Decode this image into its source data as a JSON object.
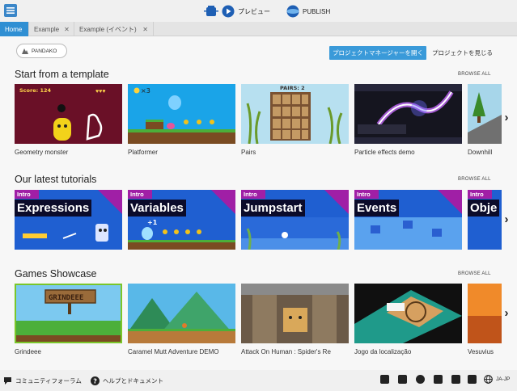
{
  "toolbar": {
    "preview_label": "プレビュー",
    "publish_label": "PUBLISH"
  },
  "tabs": [
    {
      "label": "Home"
    },
    {
      "label": "Example"
    },
    {
      "label": "Example (イベント)"
    }
  ],
  "top": {
    "pandako_label": "PANDAKO",
    "open_pm_label": "プロジェクトマネージャーを開く",
    "see_projects_label": "プロジェクトを見じる"
  },
  "templates": {
    "title": "Start from a template",
    "browse": "BROWSE ALL",
    "items": [
      {
        "label": "Geometry monster",
        "score": "Score: 124"
      },
      {
        "label": "Platformer",
        "lives": "×3"
      },
      {
        "label": "Pairs",
        "pairs": "PAIRS: 2"
      },
      {
        "label": "Particle effects demo"
      },
      {
        "label": "Downhill"
      }
    ]
  },
  "tutorials": {
    "title": "Our latest tutorials",
    "browse": "BROWSE ALL",
    "items": [
      {
        "intro": "Intro",
        "name": "Expressions"
      },
      {
        "intro": "Intro",
        "name": "Variables",
        "badge": "+1"
      },
      {
        "intro": "Intro",
        "name": "Jumpstart"
      },
      {
        "intro": "Intro",
        "name": "Events"
      },
      {
        "intro": "Intro",
        "name": "Obje"
      }
    ]
  },
  "showcase": {
    "title": "Games Showcase",
    "browse": "BROWSE ALL",
    "items": [
      {
        "label": "Grindeee",
        "sign": "GRINDEEE"
      },
      {
        "label": "Caramel Mutt Adventure DEMO"
      },
      {
        "label": "Attack On Human : Spider's Re"
      },
      {
        "label": "Jogo da localização"
      },
      {
        "label": "Vesuvius"
      }
    ]
  },
  "footer": {
    "forum_label": "コミュニティフォーラム",
    "help_label": "ヘルプとドキュメント",
    "lang_label": "JA-JP"
  },
  "colors": {
    "accent": "#2f8fd3",
    "tutorial_bg": "#1f5fd1",
    "intro_purple": "#a01fa6"
  }
}
